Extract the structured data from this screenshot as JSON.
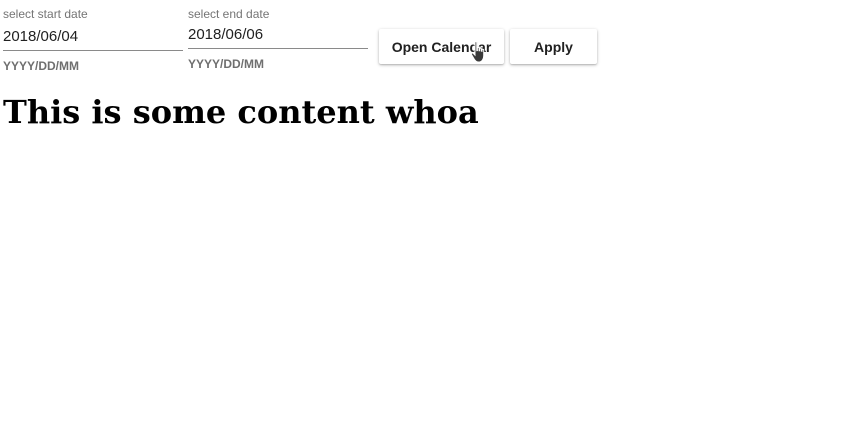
{
  "start_date": {
    "label": "select start date",
    "value": "2018/06/04",
    "hint": "YYYY/DD/MM"
  },
  "end_date": {
    "label": "select end date",
    "value": "2018/06/06",
    "hint": "YYYY/DD/MM"
  },
  "buttons": {
    "open_calendar": "Open Calendar",
    "apply": "Apply"
  },
  "content": {
    "heading": "This is some content whoa"
  },
  "cursor_icon": "hand-pointer-icon"
}
